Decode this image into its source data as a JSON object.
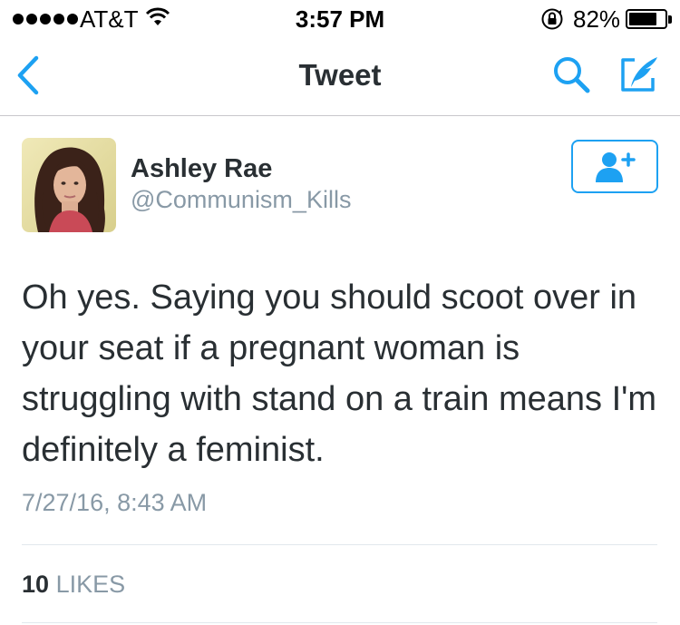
{
  "status_bar": {
    "carrier": "AT&T",
    "time": "3:57 PM",
    "battery_percent": "82%",
    "battery_level": 0.82,
    "signal_bars": 5
  },
  "nav": {
    "title": "Tweet",
    "back_icon": "chevron-left-icon",
    "search_icon": "search-icon",
    "compose_icon": "compose-tweet-icon"
  },
  "tweet": {
    "author": {
      "name": "Ashley Rae",
      "handle": "@Communism_Kills"
    },
    "follow_icon": "add-user-icon",
    "text": "Oh yes. Saying you should scoot over in your seat if a pregnant woman is struggling with stand on a train means I'm definitely a feminist.",
    "timestamp": "7/27/16, 8:43 AM",
    "likes_count": "10",
    "likes_label": "LIKES"
  },
  "colors": {
    "accent": "#1da1f2",
    "text_primary": "#292f33",
    "text_secondary": "#8899a6",
    "divider": "#e1e8ed"
  }
}
